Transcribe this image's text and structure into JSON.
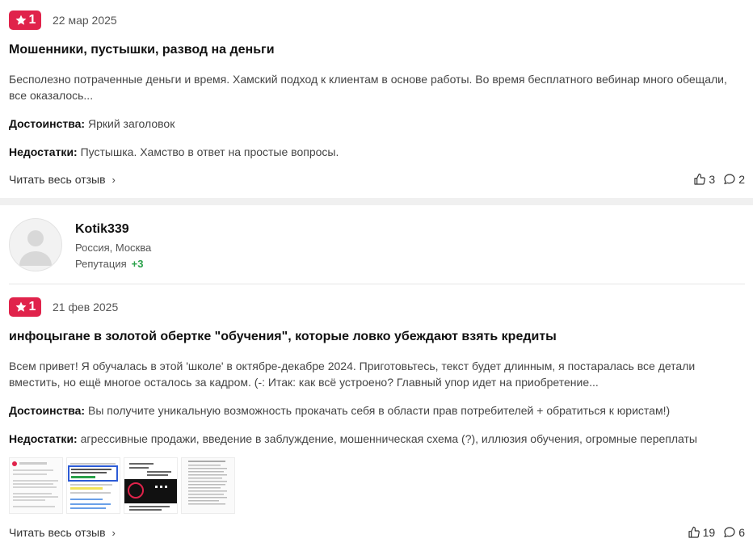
{
  "reviews": [
    {
      "rating": "1",
      "date": "22 мар 2025",
      "title": "Мошенники, пустышки, развод на деньги",
      "text": "Бесполезно потраченные деньги и время. Хамский подход к клиентам в основе работы. Во время бесплатного вебинар много обещали, все оказалось...",
      "pros_label": "Достоинства:",
      "pros": "Яркий заголовок",
      "cons_label": "Недостатки:",
      "cons": "Пустышка. Хамство в ответ на простые вопросы.",
      "read_more": "Читать весь отзыв",
      "likes": "3",
      "comments": "2"
    },
    {
      "rating": "1",
      "date": "21 фев 2025",
      "title": "инфоцыгане в золотой обертке \"обучения\", которые ловко убеждают взять кредиты",
      "text": "Всем привет! Я обучалась в этой 'школе' в октябре-декабре 2024. Приготовьтесь, текст будет длинным, я постаралась все детали вместить, но ещё многое осталось за кадром. (-: Итак: как всё устроено? Главный упор идет на приобретение...",
      "pros_label": "Достоинства:",
      "pros": "Вы получите уникальную возможность прокачать себя в области прав потребителей + обратиться к юристам!)",
      "cons_label": "Недостатки:",
      "cons": "агрессивные продажи, введение в заблуждение, мошенническая схема (?), иллюзия обучения, огромные переплаты",
      "read_more": "Читать весь отзыв",
      "likes": "19",
      "comments": "6"
    }
  ],
  "author": {
    "name": "Kotik339",
    "location": "Россия, Москва",
    "reputation_label": "Репутация",
    "reputation_value": "+3"
  },
  "colors": {
    "rating_badge": "#e0234b",
    "reputation_positive": "#2aa14a"
  },
  "icons": {
    "rating": "star-icon",
    "likes": "thumbs-up-icon",
    "comments": "comment-bubble-icon",
    "read_more": "chevron-right-icon",
    "avatar": "user-silhouette-icon"
  }
}
